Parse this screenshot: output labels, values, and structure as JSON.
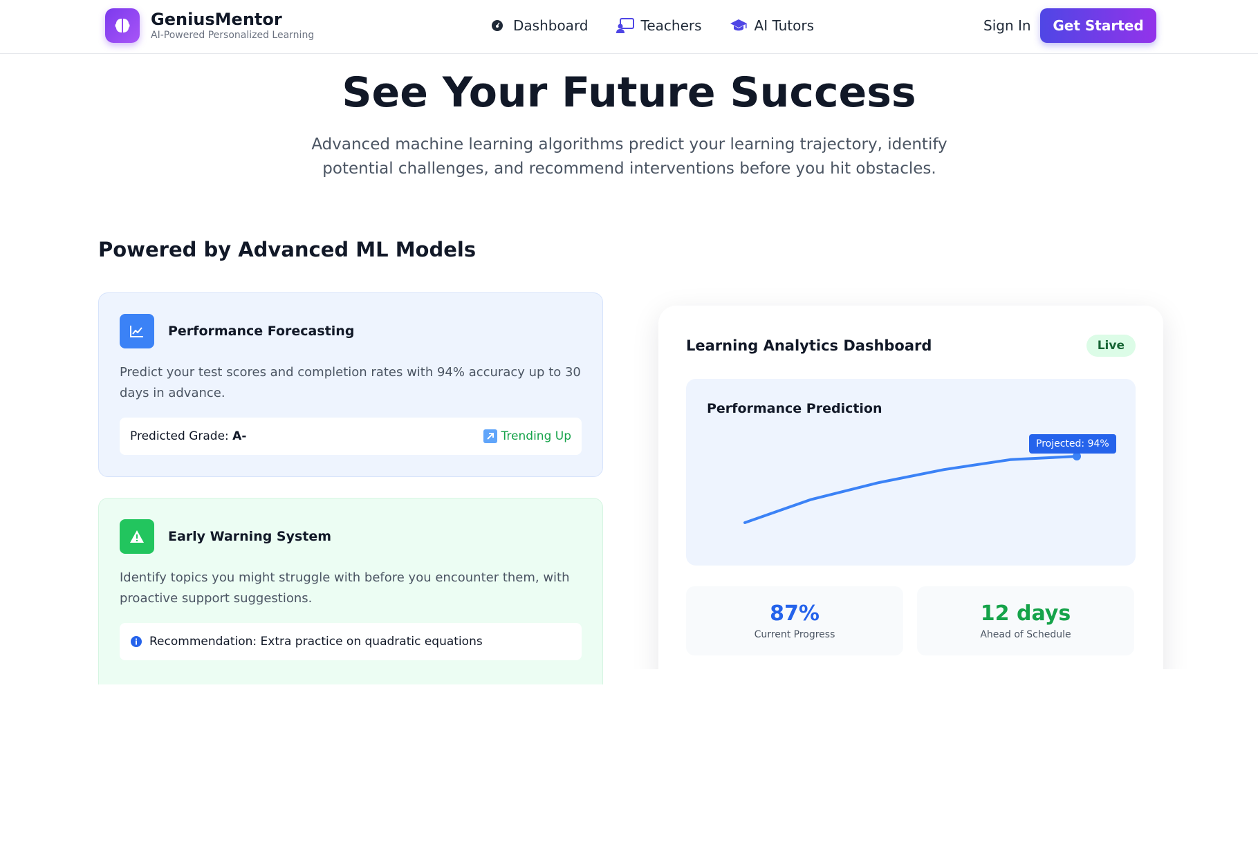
{
  "brand": {
    "name": "GeniusMentor",
    "tagline": "AI-Powered Personalized Learning",
    "icon": "brain-icon"
  },
  "nav": {
    "items": [
      {
        "label": "Dashboard",
        "icon": "dashboard-gauge-icon"
      },
      {
        "label": "Teachers",
        "icon": "teacher-icon"
      },
      {
        "label": "AI Tutors",
        "icon": "graduation-cap-icon"
      }
    ],
    "sign_in": "Sign In",
    "get_started": "Get Started"
  },
  "hero": {
    "title": "See Your Future Success",
    "subtitle": "Advanced machine learning algorithms predict your learning trajectory, identify potential challenges, and recommend interventions before you hit obstacles."
  },
  "section_title": "Powered by Advanced ML Models",
  "features": [
    {
      "title": "Performance Forecasting",
      "icon": "line-chart-icon",
      "description": "Predict your test scores and completion rates with 94% accuracy up to 30 days in advance.",
      "box_label": "Predicted Grade: ",
      "box_value": "A-",
      "trend": "Trending Up",
      "trend_icon": "arrow-up-right-icon"
    },
    {
      "title": "Early Warning System",
      "icon": "warning-triangle-icon",
      "description": "Identify topics you might struggle with before you encounter them, with proactive support suggestions.",
      "box_label": "Recommendation: Extra practice on quadratic equations",
      "box_icon": "info-icon"
    }
  ],
  "dashboard": {
    "title": "Learning Analytics Dashboard",
    "badge": "Live",
    "chart_title": "Performance Prediction",
    "projection_label": "Projected: 94%",
    "stats": [
      {
        "value": "87%",
        "label": "Current Progress"
      },
      {
        "value": "12 days",
        "label": "Ahead of Schedule"
      }
    ]
  },
  "colors": {
    "brand_gradient_start": "#7c3aed",
    "cta_start": "#4f46e5",
    "cta_end": "#9333ea",
    "accent_blue": "#3b82f6",
    "accent_green": "#22c55e"
  },
  "chart_data": {
    "type": "line",
    "title": "Performance Prediction",
    "series": [
      {
        "values": [
          0.0,
          0.35,
          0.6,
          0.8,
          0.95,
          1.0
        ]
      }
    ],
    "annotation": "Projected: 94%"
  }
}
